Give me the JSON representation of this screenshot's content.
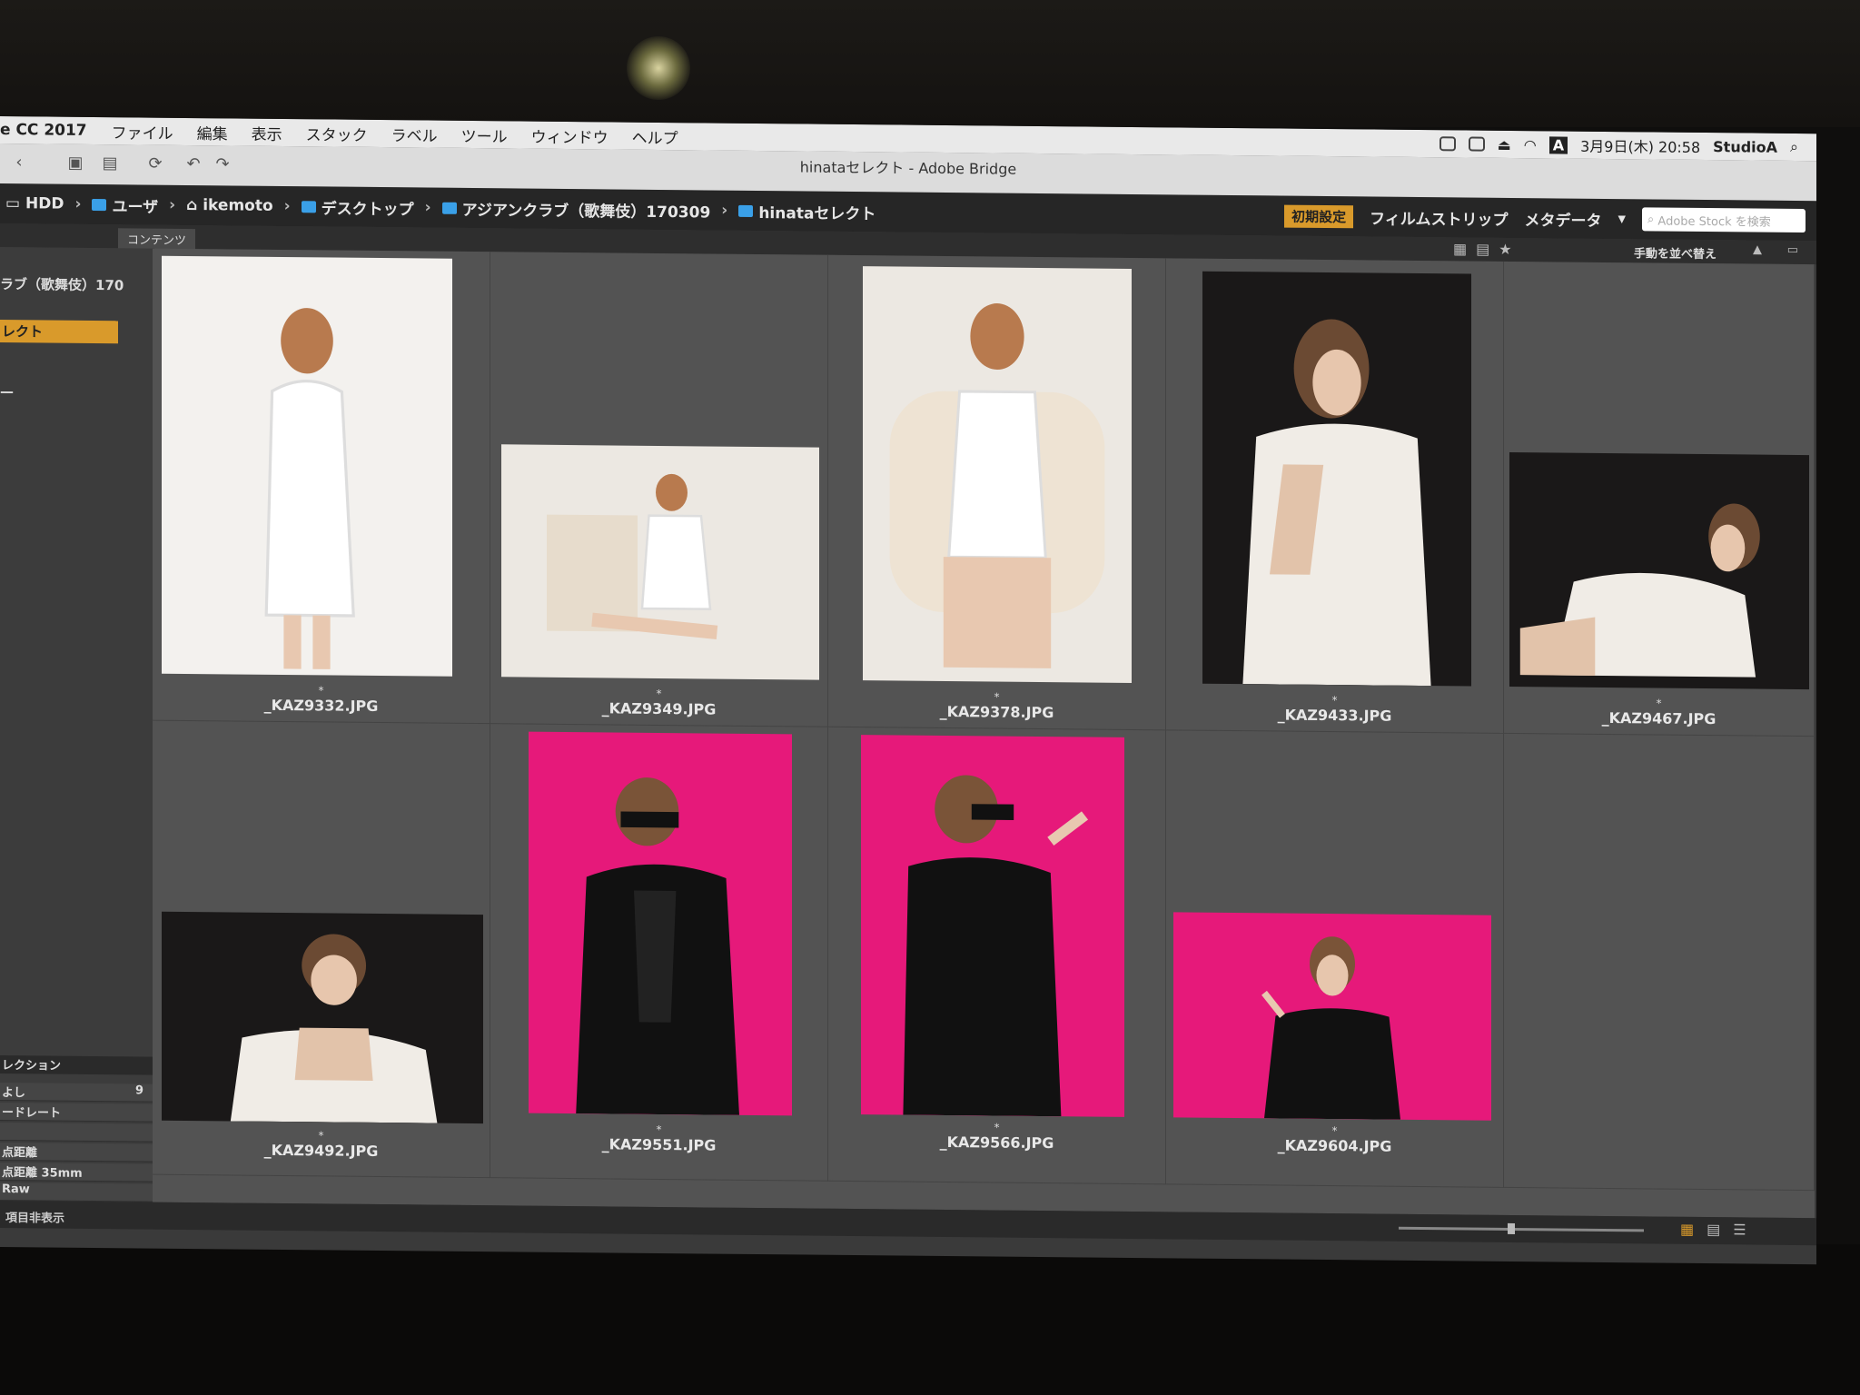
{
  "menubar": {
    "app": "e CC 2017",
    "items": [
      "ファイル",
      "編集",
      "表示",
      "スタック",
      "ラベル",
      "ツール",
      "ウィンドウ",
      "ヘルプ"
    ],
    "clock": "3月9日(木) 20:58",
    "user": "StudioA",
    "input_mode": "A"
  },
  "window": {
    "title": "hinataセレクト - Adobe Bridge"
  },
  "breadcrumb": [
    "HDD",
    "ユーザ",
    "ikemoto",
    "デスクトップ",
    "アジアンクラブ（歌舞伎）170309",
    "hinataセレクト"
  ],
  "workspaces": {
    "active": "初期設定",
    "items": [
      "フィルムストリップ",
      "メタデータ"
    ]
  },
  "search": {
    "placeholder": "Adobe Stock を検索"
  },
  "subbar": {
    "tab_content": "コンテンツ",
    "sort_label": "手動を並べ替え"
  },
  "left_panel": {
    "folder_item": "ラブ（歌舞伎）170",
    "selected_item": "レクト",
    "collection_header": "レクション",
    "rows": [
      {
        "label": "よし",
        "count": "9"
      },
      {
        "label": "ードレート",
        "count": ""
      },
      {
        "label": "",
        "count": ""
      },
      {
        "label": "点距離",
        "count": ""
      },
      {
        "label": "点距離 35mm",
        "count": ""
      },
      {
        "label": "Raw",
        "count": ""
      }
    ]
  },
  "thumbnails": [
    {
      "file": "_KAZ9332.JPG",
      "rating": "*"
    },
    {
      "file": "_KAZ9349.JPG",
      "rating": "*"
    },
    {
      "file": "_KAZ9378.JPG",
      "rating": "*"
    },
    {
      "file": "_KAZ9433.JPG",
      "rating": "*"
    },
    {
      "file": "_KAZ9467.JPG",
      "rating": "*"
    },
    {
      "file": "_KAZ9492.JPG",
      "rating": "*"
    },
    {
      "file": "_KAZ9551.JPG",
      "rating": "*"
    },
    {
      "file": "_KAZ9566.JPG",
      "rating": "*"
    },
    {
      "file": "_KAZ9604.JPG",
      "rating": "*"
    }
  ],
  "statusbar": {
    "hide_label": "項目非表示"
  },
  "colors": {
    "accent": "#d99a2b",
    "folder": "#3aa0e8",
    "pink_bg": "#e6197a"
  }
}
